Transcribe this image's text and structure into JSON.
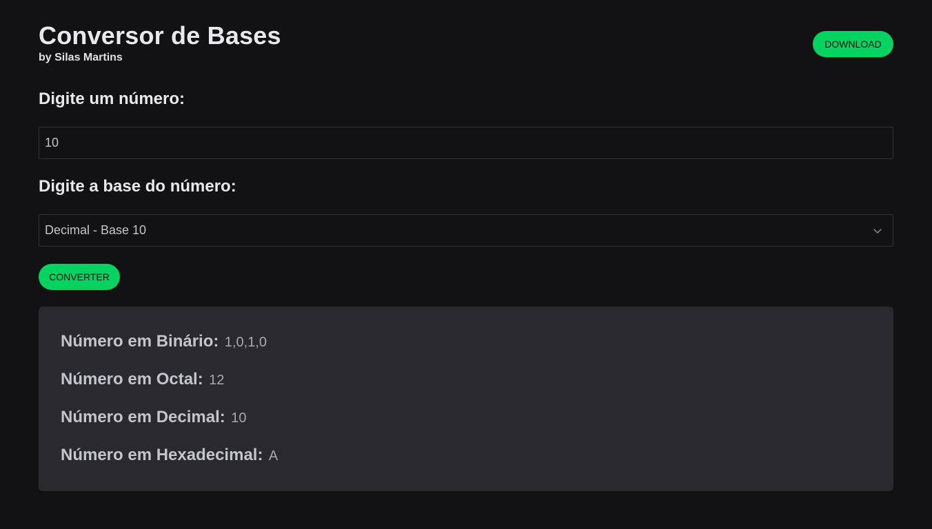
{
  "header": {
    "title": "Conversor de Bases",
    "subtitle": "by Silas Martins",
    "download_label": "DOWNLOAD"
  },
  "form": {
    "number_label": "Digite um número:",
    "number_value": "10",
    "base_label": "Digite a base do número:",
    "base_selected": "Decimal - Base 10",
    "convert_label": "CONVERTER"
  },
  "results": [
    {
      "label": "Número em Binário:",
      "value": "1,0,1,0"
    },
    {
      "label": "Número em Octal:",
      "value": "12"
    },
    {
      "label": "Número em Decimal:",
      "value": "10"
    },
    {
      "label": "Número em Hexadecimal:",
      "value": "A"
    }
  ],
  "icons": {
    "select_arrow": "chevron-down-icon"
  },
  "colors": {
    "accent": "#04d361",
    "background": "#121214",
    "panel": "#29292e"
  }
}
